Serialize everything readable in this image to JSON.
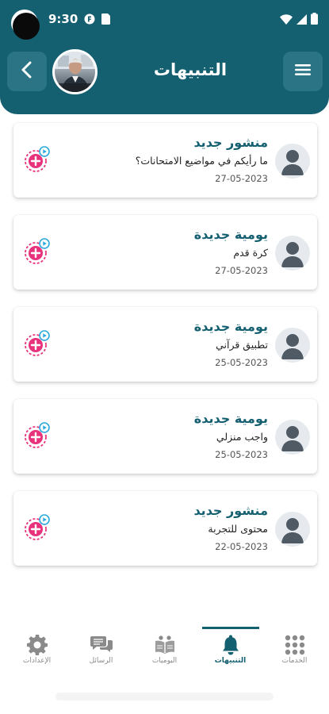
{
  "status_bar": {
    "time": "9:30"
  },
  "header": {
    "title": "التنبيهات"
  },
  "notifications": [
    {
      "title": "منشور جديد",
      "subtitle": "ما رأيكم في مواضيع الامتحانات؟",
      "date": "27-05-2023"
    },
    {
      "title": "يومية جديدة",
      "subtitle": "كرة قدم",
      "date": "27-05-2023"
    },
    {
      "title": "يومية جديدة",
      "subtitle": "تطبيق قرآني",
      "date": "25-05-2023"
    },
    {
      "title": "يومية جديدة",
      "subtitle": "واجب منزلي",
      "date": "25-05-2023"
    },
    {
      "title": "منشور جديد",
      "subtitle": "محتوى للتجربة",
      "date": "22-05-2023"
    }
  ],
  "bottom_nav": {
    "items": [
      {
        "label": "الخدمات",
        "icon": "grid-icon"
      },
      {
        "label": "التنبيهات",
        "icon": "bell-icon",
        "active": true
      },
      {
        "label": "اليوميات",
        "icon": "diary-icon"
      },
      {
        "label": "الرسائل",
        "icon": "chat-icon"
      },
      {
        "label": "الإعدادات",
        "icon": "gear-icon"
      }
    ]
  },
  "colors": {
    "primary": "#145f70",
    "button": "#2b7485",
    "badge": "#e8327c",
    "badge_accent": "#2aa8e0"
  }
}
